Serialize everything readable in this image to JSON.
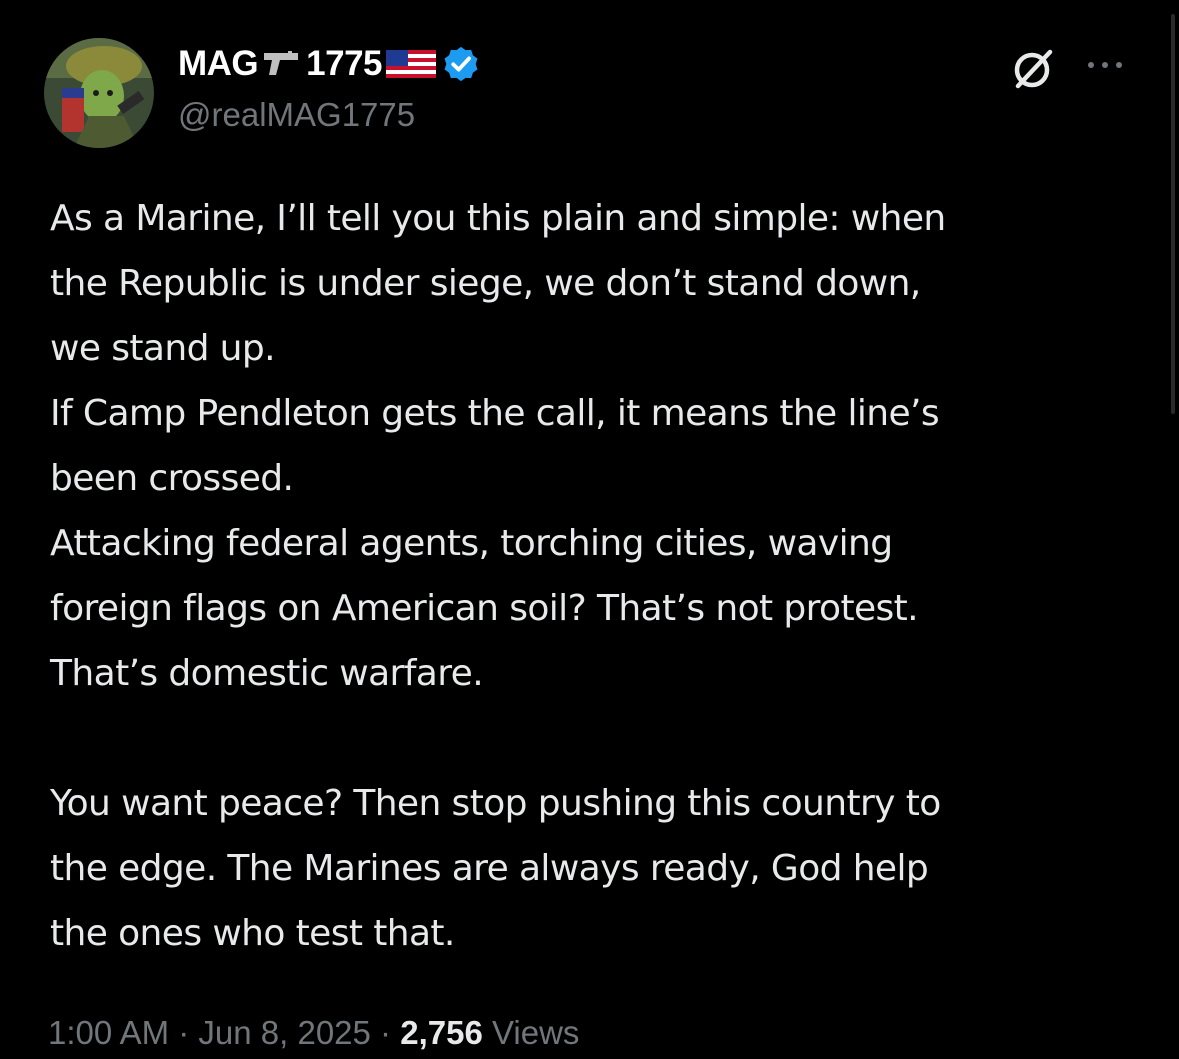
{
  "author": {
    "display_name_prefix": "MAG",
    "display_name_suffix": "1775",
    "handle": "@realMAG1775",
    "verified": true,
    "gun_emoji": "pistol-icon",
    "flag_emoji": "us-flag-icon"
  },
  "actions": {
    "grok": "grok-icon",
    "more": "more-options-icon"
  },
  "tweet": {
    "line_1": "As a Marine, I’ll tell you this plain and simple: when",
    "line_2": "the Republic is under siege, we don’t stand down,",
    "line_3": "we stand up.",
    "line_4": "If Camp Pendleton gets the call, it means the line’s",
    "line_5": "been crossed.",
    "line_6": "Attacking federal agents, torching cities, waving",
    "line_7": "foreign flags on American soil? That’s not protest.",
    "line_8": "That’s domestic warfare.",
    "line_9": "You want peace? Then stop pushing this country to",
    "line_10": "the edge. The Marines are always ready, God help",
    "line_11": "the ones who test that."
  },
  "meta": {
    "time": "1:00 AM",
    "sep1": " · ",
    "date": "Jun 8, 2025",
    "sep2": " · ",
    "views_count": "2,756",
    "views_label": " Views"
  },
  "colors": {
    "background": "#000000",
    "text": "#e7e9ea",
    "muted": "#71767b",
    "verified_blue": "#1d9bf0"
  }
}
